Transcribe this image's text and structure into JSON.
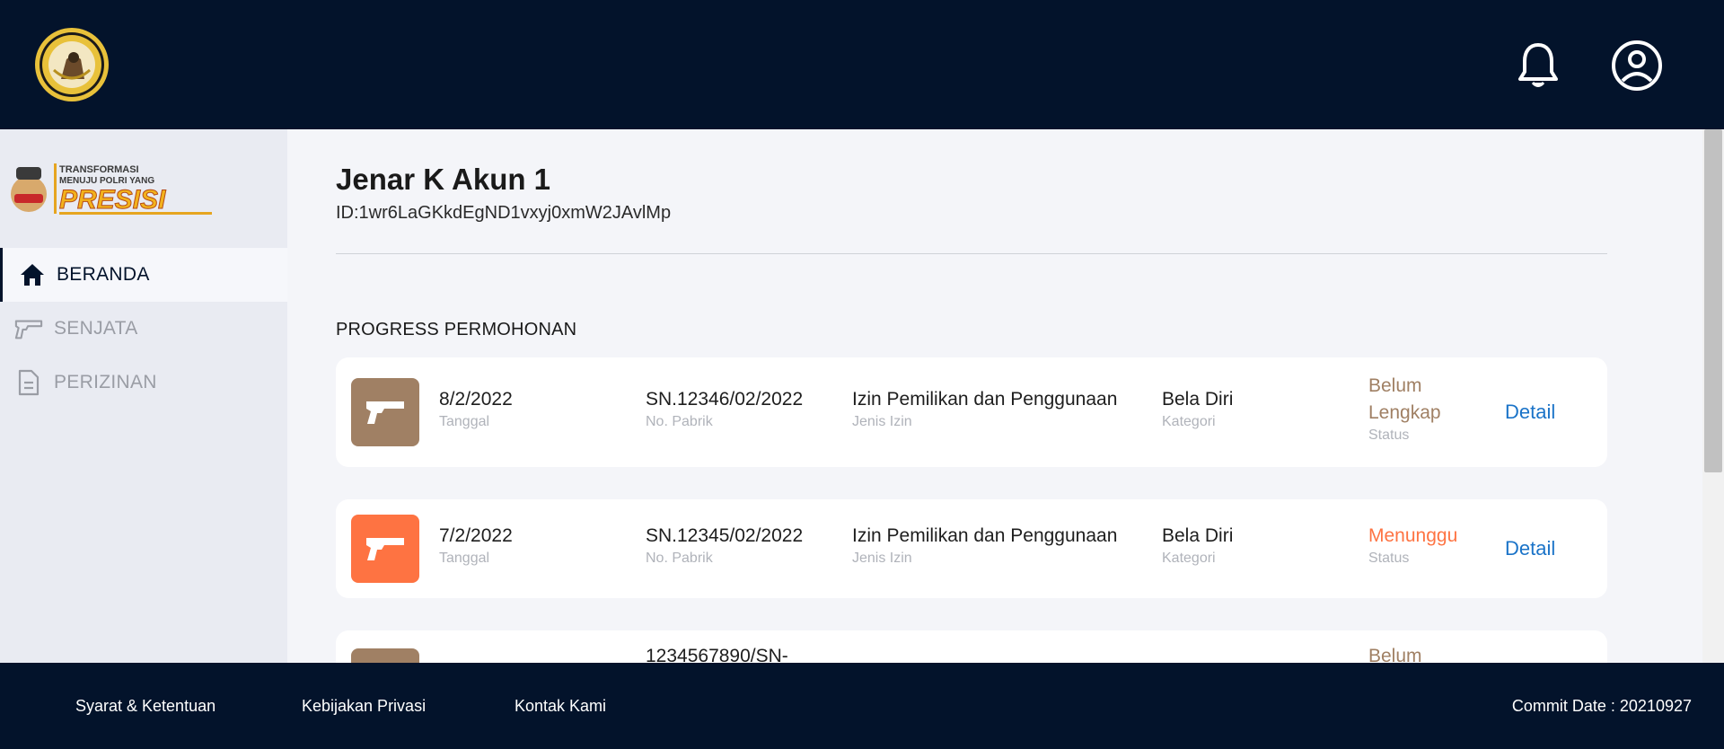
{
  "header": {
    "logo_icon": "police-seal-logo",
    "notification_icon": "bell-icon",
    "profile_icon": "user-circle-icon",
    "background_color": "#03132b"
  },
  "sidebar": {
    "logo": {
      "icon": "presisi-logo",
      "lines": [
        "TRANSFORMASI",
        "MENUJU POLRI YANG",
        "PRESISI"
      ]
    },
    "items": [
      {
        "label": "BERANDA",
        "icon": "home-icon",
        "active": true
      },
      {
        "label": "SENJATA",
        "icon": "pistol-icon",
        "active": false
      },
      {
        "label": "PERIZINAN",
        "icon": "document-icon",
        "active": false
      }
    ]
  },
  "account": {
    "name": "Jenar K Akun 1",
    "id": "ID:1wr6LaGKkdEgND1vxyj0xmW2JAvlMp"
  },
  "progress": {
    "title": "PROGRESS PERMOHONAN",
    "cards": [
      {
        "thumb_color": "#a08064",
        "date": "8/2/2022",
        "date_label": "Tanggal",
        "serial": "SN.12346/02/2022",
        "serial_label": "No. Pabrik",
        "permit_type": "Izin Pemilikan dan Penggunaan",
        "permit_type_label": "Jenis Izin",
        "category": "Bela Diri",
        "category_label": "Kategori",
        "status_line1": "Belum",
        "status_line2": "Lengkap",
        "status_label": "Status",
        "status_color": "#a08064",
        "detail_label": "Detail"
      },
      {
        "thumb_color": "#fe7342",
        "date": "7/2/2022",
        "date_label": "Tanggal",
        "serial": "SN.12345/02/2022",
        "serial_label": "No. Pabrik",
        "permit_type": "Izin Pemilikan dan Penggunaan",
        "permit_type_label": "Jenis Izin",
        "category": "Bela Diri",
        "category_label": "Kategori",
        "status": "Menunggu",
        "status_label": "Status",
        "status_color": "#fe7342",
        "detail_label": "Detail"
      },
      {
        "thumb_color": "#a08064",
        "serial": "1234567890/SN-",
        "status_line1": "Belum",
        "status_color": "#a08064"
      }
    ]
  },
  "footer": {
    "links": [
      "Syarat & Ketentuan",
      "Kebijakan Privasi",
      "Kontak Kami"
    ],
    "commit": "Commit Date : 20210927"
  },
  "colors": {
    "navy": "#03132b",
    "link_blue": "#1a73c8",
    "status_brown": "#a08064",
    "status_orange": "#fe7342"
  }
}
